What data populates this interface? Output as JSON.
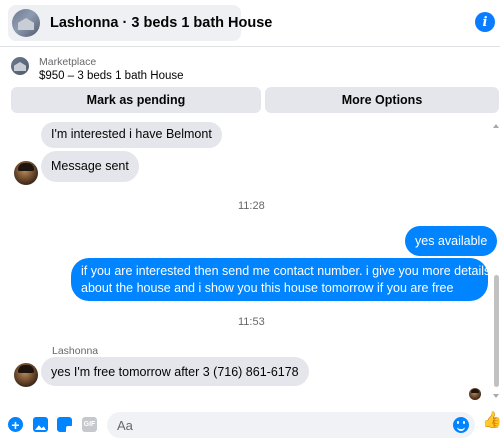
{
  "header": {
    "title": "Lashonna · 3 beds 1 bath House",
    "info_icon": "info-icon"
  },
  "marketplace": {
    "label": "Marketplace",
    "listing": "$950 – 3 beds 1 bath House",
    "buttons": {
      "pending": "Mark as pending",
      "more": "More Options"
    }
  },
  "chat": {
    "messages": [
      {
        "side": "in",
        "text": "I'm interested i have Belmont"
      },
      {
        "side": "in",
        "text": "Message sent"
      },
      {
        "kind": "time",
        "text": "11:28"
      },
      {
        "side": "out",
        "text": "yes available"
      },
      {
        "side": "out",
        "lines": [
          "if you are interested then send me contact number. i give you more details",
          "about the house and i show you this house tomorrow if you are free"
        ]
      },
      {
        "kind": "time",
        "text": "11:53"
      },
      {
        "kind": "sender",
        "text": "Lashonna"
      },
      {
        "side": "in",
        "text": "yes I'm free tomorrow after 3 (716) 861-6178"
      }
    ]
  },
  "composer": {
    "placeholder": "Aa",
    "gif_label": "GIF",
    "icons": [
      "plus-icon",
      "photo-icon",
      "sticker-icon",
      "gif-icon",
      "emoji-icon",
      "like-icon"
    ]
  },
  "colors": {
    "accent": "#0084ff",
    "incoming_bubble": "#e4e6eb",
    "muted_text": "#65676b"
  }
}
